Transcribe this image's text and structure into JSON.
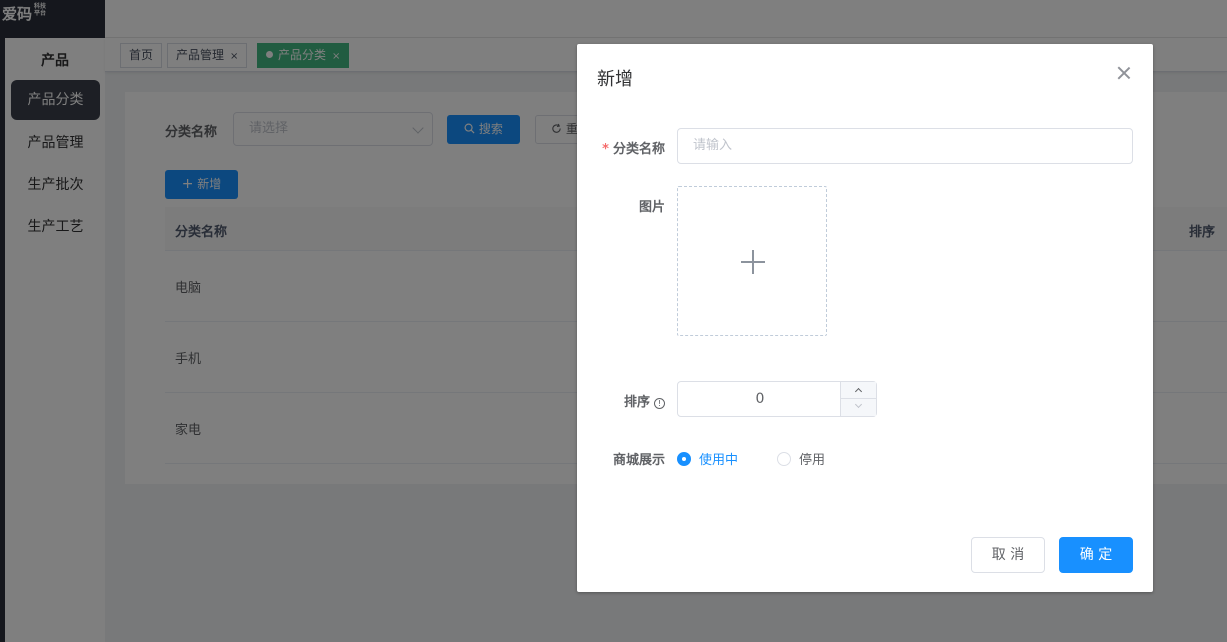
{
  "logo": {
    "text": "爱码",
    "mini_top": "科技",
    "mini_bottom": "平台"
  },
  "sidebar": {
    "header": "产品",
    "items": [
      {
        "label": "产品分类",
        "active": true
      },
      {
        "label": "产品管理",
        "active": false
      },
      {
        "label": "生产批次",
        "active": false
      },
      {
        "label": "生产工艺",
        "active": false
      }
    ]
  },
  "tabs": [
    {
      "label": "首页",
      "closable": false,
      "active": false
    },
    {
      "label": "产品管理",
      "closable": true,
      "active": false
    },
    {
      "label": "产品分类",
      "closable": true,
      "active": true
    }
  ],
  "tab_close_glyph": "×",
  "search": {
    "label": "分类名称",
    "placeholder": "请选择",
    "search_button": "搜索",
    "reset_button": "重"
  },
  "toolbar": {
    "add_button": "新增"
  },
  "table": {
    "columns": [
      "分类名称",
      "排序"
    ],
    "rows": [
      {
        "name": "电脑"
      },
      {
        "name": "手机"
      },
      {
        "name": "家电"
      }
    ]
  },
  "dialog": {
    "title": "新增",
    "fields": {
      "name": {
        "label": "分类名称",
        "required": true,
        "placeholder": "请输入",
        "value": ""
      },
      "image": {
        "label": "图片"
      },
      "sort": {
        "label": "排序",
        "value": "0",
        "info_glyph": "!"
      },
      "display": {
        "label": "商城展示",
        "options": [
          {
            "label": "使用中",
            "checked": true
          },
          {
            "label": "停用",
            "checked": false
          }
        ]
      }
    },
    "cancel_button": "取 消",
    "confirm_button": "确 定"
  },
  "colors": {
    "primary": "#1890ff",
    "active_tab": "#42b983",
    "sidebar_dark": "#2b2f3a",
    "required": "#f56c6c"
  }
}
